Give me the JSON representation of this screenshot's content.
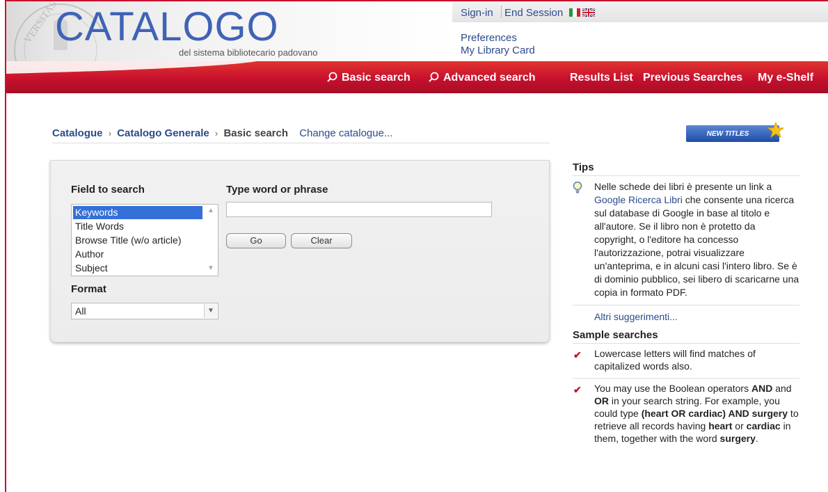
{
  "header": {
    "logo": "CATALOGO",
    "subtitle": "del sistema bibliotecario padovano",
    "seal_text": "VERSITAS STUDII",
    "sign_in": "Sign-in",
    "end_session": "End Session",
    "preferences": "Preferences",
    "library_card": "My Library Card"
  },
  "nav": {
    "basic_search": "Basic search",
    "advanced_search": "Advanced search",
    "results_list": "Results List",
    "previous_searches": "Previous Searches",
    "eshelf": "My e-Shelf"
  },
  "breadcrumb": {
    "catalogue": "Catalogue",
    "general": "Catalogo Generale",
    "current": "Basic search",
    "change": "Change catalogue..."
  },
  "new_titles": "NEW TITLES",
  "search": {
    "field_label": "Field to search",
    "word_label": "Type word or phrase",
    "fields": [
      "Keywords",
      "Title Words",
      "Browse Title (w/o article)",
      "Author",
      "Subject"
    ],
    "selected_field": "Keywords",
    "word_value": "",
    "go": "Go",
    "clear": "Clear",
    "format_label": "Format",
    "format_value": "All"
  },
  "tips": {
    "heading": "Tips",
    "text_before": "Nelle schede dei libri è presente un link a ",
    "link": "Google Ricerca Libri",
    "text_after": " che consente una ricerca sul database di Google in base al titolo e all'autore. Se il libro non è protetto da copyright, o l'editore ha concesso l'autorizzazione, potrai visualizzare un'anteprima, e in alcuni casi l'intero libro. Se è di dominio pubblico, sei libero di scaricarne una copia in formato PDF.",
    "more": "Altri suggerimenti..."
  },
  "samples": {
    "heading": "Sample searches",
    "item1": "Lowercase letters will find matches of capitalized words also.",
    "item2": {
      "p1": "You may use the Boolean operators ",
      "and1": "AND",
      "p2": " and ",
      "or1": "OR",
      "p3": " in your search string. For example, you could type ",
      "example": "(heart OR cardiac) AND surgery",
      "p4": " to retrieve all records having ",
      "heart": "heart",
      "p5": " or ",
      "cardiac": "cardiac",
      "p6": " in them, together with the word ",
      "surgery": "surgery",
      "p7": "."
    }
  },
  "colors": {
    "brand_red": "#c8102e",
    "link_blue": "#2b4a8c",
    "logo_blue": "#3f63b5",
    "selection_blue": "#3470d8"
  }
}
